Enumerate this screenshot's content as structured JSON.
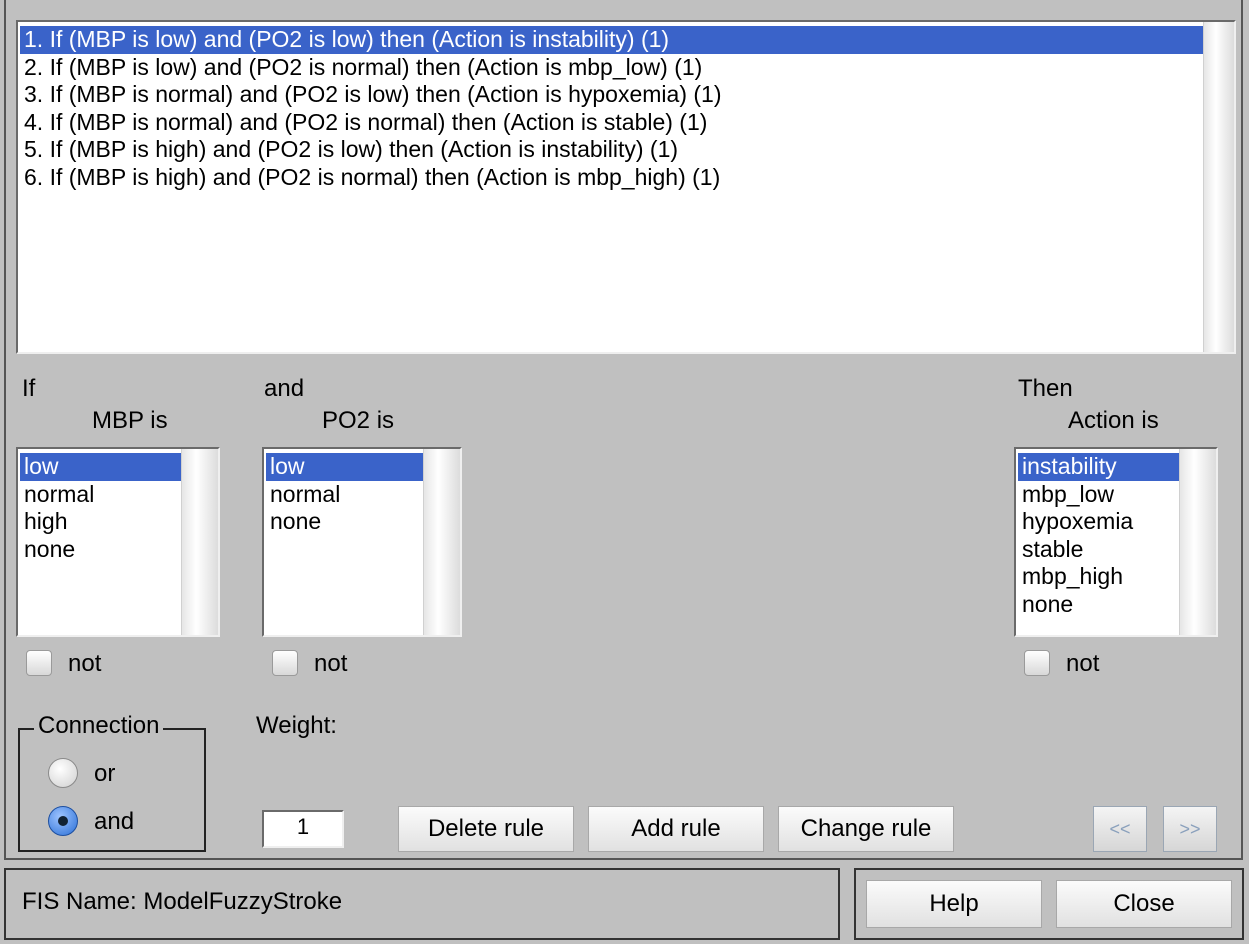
{
  "rules": [
    "1. If (MBP is low) and (PO2 is low) then (Action is instability) (1)",
    "2. If (MBP is low) and (PO2 is normal) then (Action is mbp_low) (1)",
    "3. If (MBP is normal) and (PO2 is low) then (Action is hypoxemia) (1)",
    "4. If (MBP is normal) and (PO2 is normal) then (Action is stable) (1)",
    "5. If (MBP is high) and (PO2 is low) then (Action is instability) (1)",
    "6. If (MBP is high) and (PO2 is normal) then (Action is mbp_high) (1)"
  ],
  "selected_rule_index": 0,
  "if_block": {
    "prefix": "If",
    "title": "MBP is",
    "options": [
      "low",
      "normal",
      "high",
      "none"
    ],
    "selected": "low",
    "not_label": "not"
  },
  "and_block": {
    "prefix": "and",
    "title": "PO2 is",
    "options": [
      "low",
      "normal",
      "none"
    ],
    "selected": "low",
    "not_label": "not"
  },
  "then_block": {
    "prefix": "Then",
    "title": "Action is",
    "options": [
      "instability",
      "mbp_low",
      "hypoxemia",
      "stable",
      "mbp_high",
      "none"
    ],
    "selected": "instability",
    "not_label": "not"
  },
  "connection": {
    "title": "Connection",
    "options": [
      "or",
      "and"
    ],
    "selected": "and"
  },
  "weight": {
    "label": "Weight:",
    "value": "1"
  },
  "buttons": {
    "delete_rule": "Delete rule",
    "add_rule": "Add rule",
    "change_rule": "Change rule",
    "prev": "<<",
    "next": ">>",
    "help": "Help",
    "close": "Close"
  },
  "status": {
    "fis_name": "FIS Name: ModelFuzzyStroke"
  },
  "colors": {
    "selection": "#3a63c9",
    "background": "#c0c0c0"
  }
}
